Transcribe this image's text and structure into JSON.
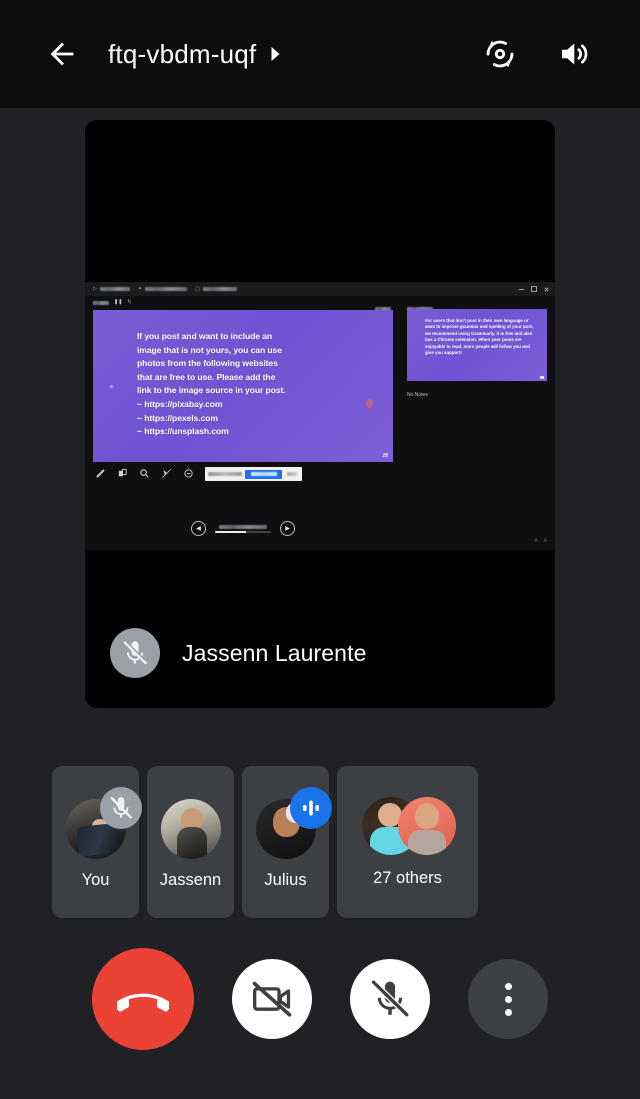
{
  "header": {
    "back_label": "Back",
    "meeting_code": "ftq-vbdm-uqf",
    "expand_caret": "▶",
    "switch_camera_label": "Switch camera",
    "speaker_label": "Speaker"
  },
  "stage": {
    "active_speaker_name": "Jassenn Laurente",
    "mic_status": "muted"
  },
  "shared_screen": {
    "window_tabs": [
      "",
      "",
      ""
    ],
    "timer": "",
    "slide_counter": "",
    "next_slide_label": "Next slide",
    "no_notes_label": "No Notes",
    "slide": {
      "body": "If you post and want to include an\nimage that is not yours, you can use\nphotos from the following websites\nthat are free to use. Please add the\nlink to the image source in your post.\n~ https://pixabay.com\n~ https://pexels.com\n~ https://unsplash.com",
      "page_number": "28"
    },
    "next_slide_thumb": {
      "body": "For users that don't post in their own language or want to improve grammar and spelling of your post, we recommend using Grammarly, it is free and also has a Chrome extension. When your posts are enjoyable to read, more people will follow you and give you support!"
    },
    "toolbar_icons": [
      "pen-icon",
      "laser-icon",
      "zoom-icon",
      "pointer-icon",
      "minus-icon"
    ],
    "toast": {
      "message": "",
      "primary_button": "",
      "secondary_button": ""
    },
    "nav": {
      "prev": "◀",
      "next": "▶",
      "label": ""
    }
  },
  "participants": [
    {
      "name": "You",
      "avatar": "av-you",
      "badge": "mic-off-icon"
    },
    {
      "name": "Jassenn",
      "avatar": "av-jassenn",
      "badge": "none"
    },
    {
      "name": "Julius",
      "avatar": "av-julius",
      "badge": "speaking-icon"
    },
    {
      "name": "27 others",
      "avatar": "duo",
      "badge": "none"
    }
  ],
  "controls": [
    {
      "name": "End call",
      "icon": "end-call-icon",
      "style": "end"
    },
    {
      "name": "Turn on camera",
      "icon": "camera-off-icon",
      "style": "light"
    },
    {
      "name": "Unmute microphone",
      "icon": "mic-off-icon",
      "style": "light"
    },
    {
      "name": "More options",
      "icon": "more-vertical-icon",
      "style": "more"
    }
  ],
  "colors": {
    "background": "#202124",
    "tile": "#3c4043",
    "end_call": "#ea4335",
    "speaking_badge": "#1a73e8",
    "mute_badge": "#9aa0a6",
    "slide_purple": "#7a5cd6"
  }
}
